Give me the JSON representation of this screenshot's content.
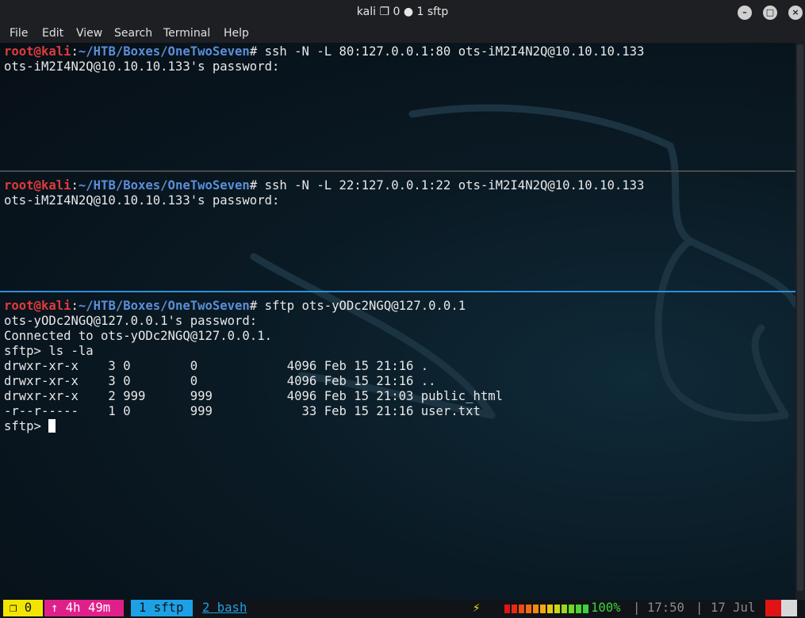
{
  "window": {
    "title": "kali ❐ 0 ● 1 sftp",
    "minimize_label": "–",
    "maximize_label": "□",
    "close_label": "×"
  },
  "menu": [
    "File",
    "Edit",
    "View",
    "Search",
    "Terminal",
    "Help"
  ],
  "panes": [
    {
      "prompt_user": "root@kali",
      "prompt_sep": ":",
      "prompt_path": "~/HTB/Boxes/OneTwoSeven",
      "prompt_char": "#",
      "command": " ssh -N -L 80:127.0.0.1:80 ots-iM2I4N2Q@10.10.10.133",
      "output": [
        "ots-iM2I4N2Q@10.10.10.133's password:"
      ]
    },
    {
      "prompt_user": "root@kali",
      "prompt_sep": ":",
      "prompt_path": "~/HTB/Boxes/OneTwoSeven",
      "prompt_char": "#",
      "command": " ssh -N -L 22:127.0.0.1:22 ots-iM2I4N2Q@10.10.10.133",
      "output": [
        "ots-iM2I4N2Q@10.10.10.133's password:"
      ]
    },
    {
      "prompt_user": "root@kali",
      "prompt_sep": ":",
      "prompt_path": "~/HTB/Boxes/OneTwoSeven",
      "prompt_char": "#",
      "command": " sftp ots-yODc2NGQ@127.0.0.1",
      "output": [
        "ots-yODc2NGQ@127.0.0.1's password:",
        "Connected to ots-yODc2NGQ@127.0.0.1.",
        "sftp> ls -la",
        "drwxr-xr-x    3 0        0            4096 Feb 15 21:16 .",
        "drwxr-xr-x    3 0        0            4096 Feb 15 21:16 ..",
        "drwxr-xr-x    2 999      999          4096 Feb 15 21:03 public_html",
        "-r--r-----    1 0        999            33 Feb 15 21:16 user.txt"
      ],
      "current_prompt": "sftp> "
    }
  ],
  "status": {
    "session": "❐ 0",
    "uptime": "↑ 4h 49m",
    "window_active": "1 sftp",
    "window_other": "2 bash",
    "power_icon": "⚡",
    "battery": "100%",
    "battery_level": 1.0,
    "sep1": "|",
    "time": "17:50",
    "sep2": "|",
    "date": "17 Jul"
  },
  "colors": {
    "prompt_user": "#e03b3b",
    "prompt_path": "#5b8ed8",
    "active_pane_border": "#2f8fd8",
    "inactive_pane_border": "#4a4a4a",
    "status_session_bg": "#f2e600",
    "status_uptime_bg": "#e0208a",
    "status_active_window_bg": "#1ea0e6",
    "battery_green": "#3cd23c"
  }
}
